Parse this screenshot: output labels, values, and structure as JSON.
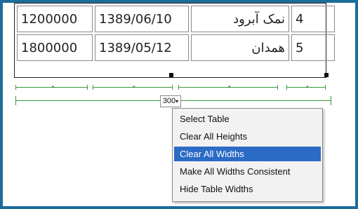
{
  "table": {
    "rows": [
      {
        "amount": "1200000",
        "date": "1389/06/10",
        "name": "نمک آبرود",
        "index": "4"
      },
      {
        "amount": "1800000",
        "date": "1389/05/12",
        "name": "همدان",
        "index": "5"
      }
    ]
  },
  "width_control": {
    "value": "300",
    "caret": "▾"
  },
  "context_menu": {
    "items": [
      "Select Table",
      "Clear All Heights",
      "Clear All Widths",
      "Make All Widths Consistent",
      "Hide Table Widths"
    ],
    "highlighted_item": "Clear All Widths"
  },
  "colors": {
    "frame": "#1c6c9c",
    "guide_green": "#3a9a3a",
    "highlight": "#2b6bc6"
  }
}
